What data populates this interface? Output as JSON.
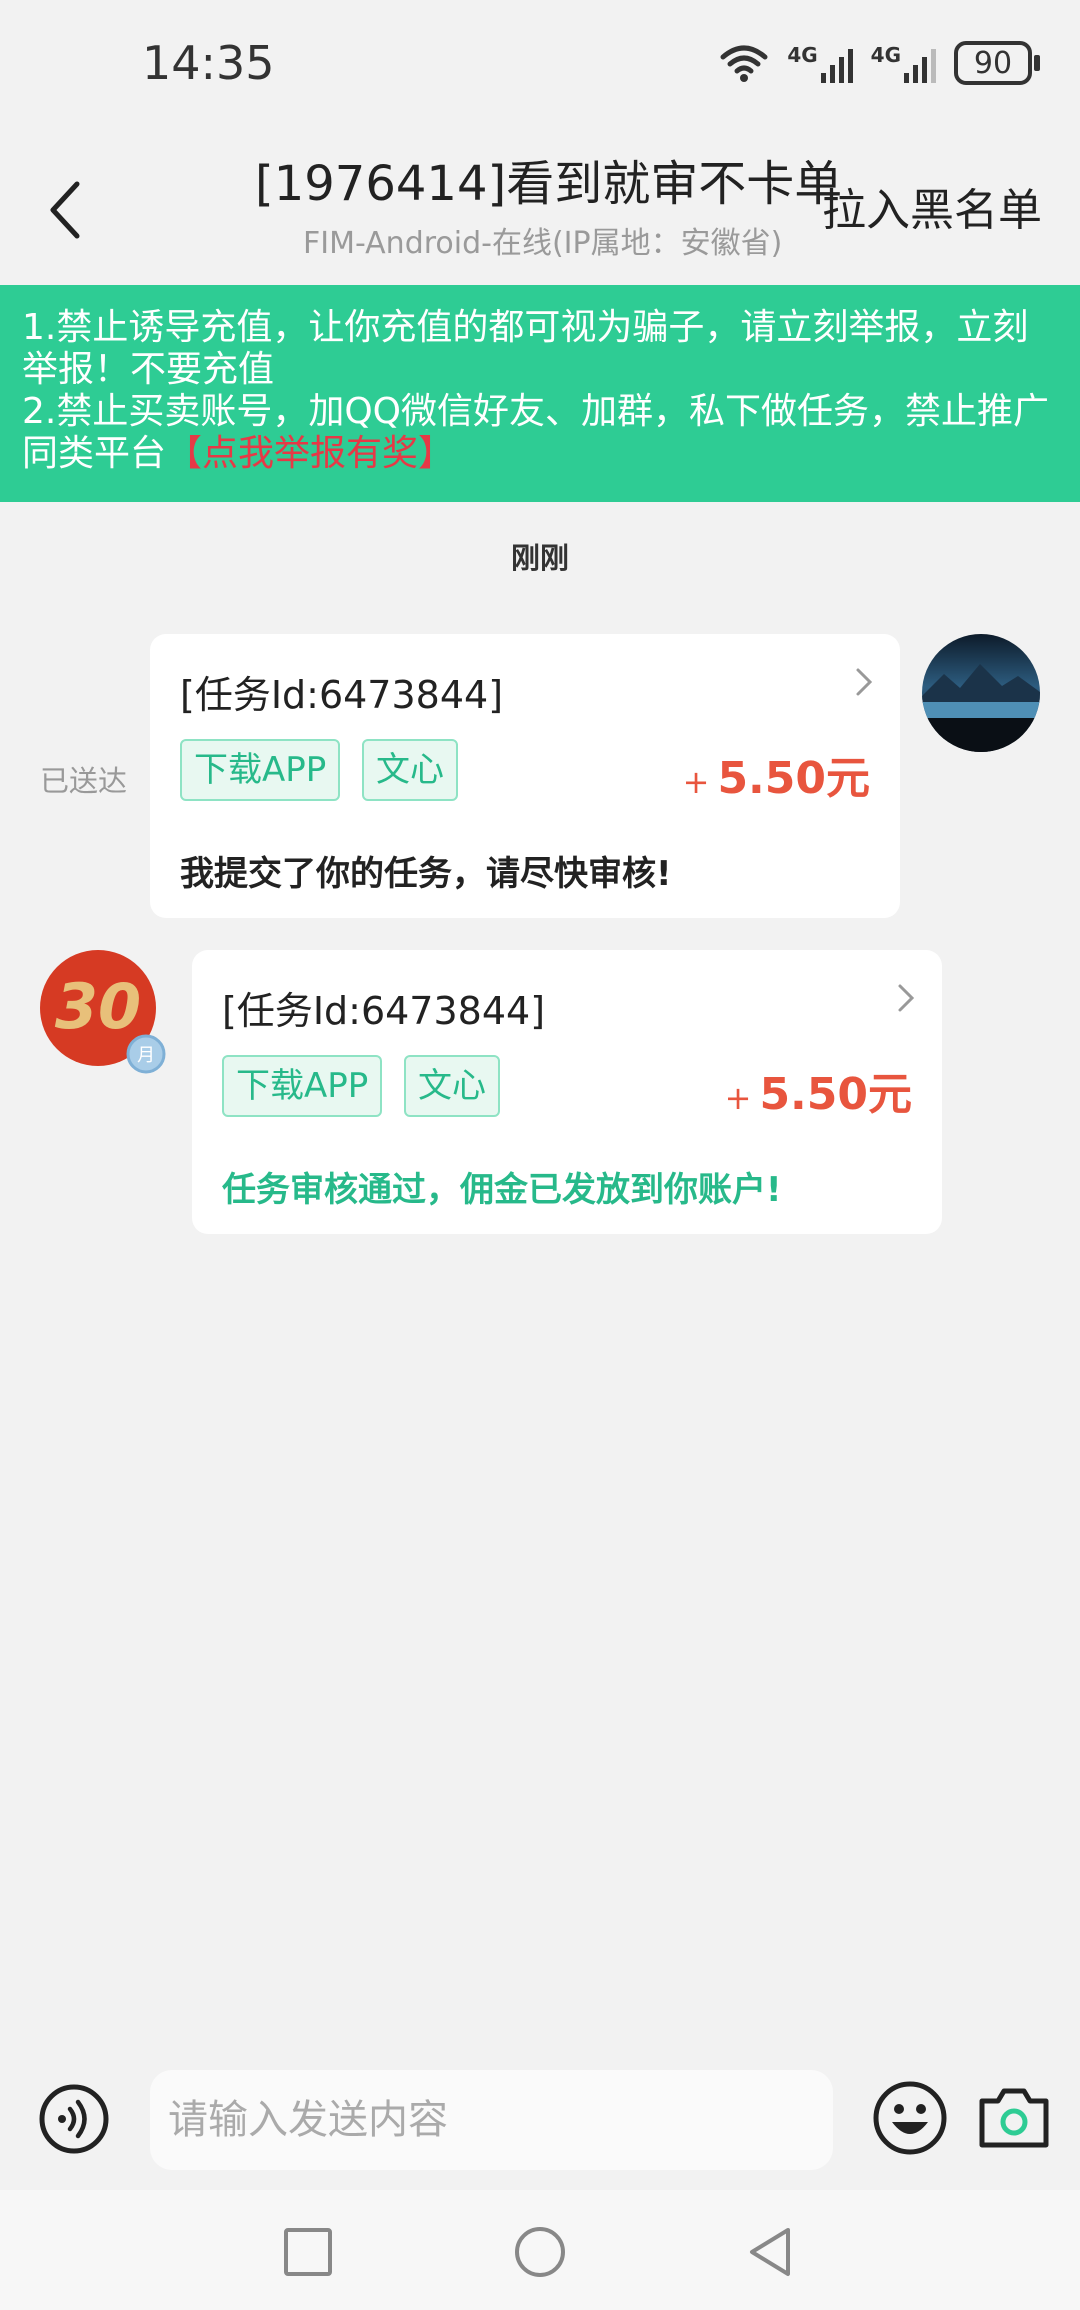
{
  "status_bar": {
    "time": "14:35",
    "signal1": "4G",
    "signal2": "4G",
    "battery": "90"
  },
  "header": {
    "title": "[1976414]看到就审不卡单",
    "subtitle": "FIM-Android-在线(IP属地：安徽省)",
    "blacklist_label": "拉入黑名单"
  },
  "notice": {
    "line1": "1.禁止诱导充值，让你充值的都可视为骗子，请立刻举报，立刻举报！不要充值",
    "line2": "2.禁止买卖账号，加QQ微信好友、加群，私下做任务，禁止推广同类平台",
    "report_link": "【点我举报有奖】"
  },
  "chat": {
    "timestamp": "刚刚",
    "delivered_label": "已送达",
    "messages": [
      {
        "task_id": "[任务Id:6473844]",
        "tags": [
          "下载APP",
          "文心"
        ],
        "reward_plus": "+",
        "reward": "5.50元",
        "text": "我提交了你的任务，请尽快审核!"
      },
      {
        "task_id": "[任务Id:6473844]",
        "tags": [
          "下载APP",
          "文心"
        ],
        "reward_plus": "+",
        "reward": "5.50元",
        "text": "任务审核通过，佣金已发放到你账户!",
        "avatar_badge": "30",
        "avatar_sub": "月"
      }
    ]
  },
  "input": {
    "placeholder": "请输入发送内容"
  },
  "colors": {
    "accent_green": "#2ecc94",
    "reward_red": "#e8553e",
    "report_red": "#e63946"
  }
}
